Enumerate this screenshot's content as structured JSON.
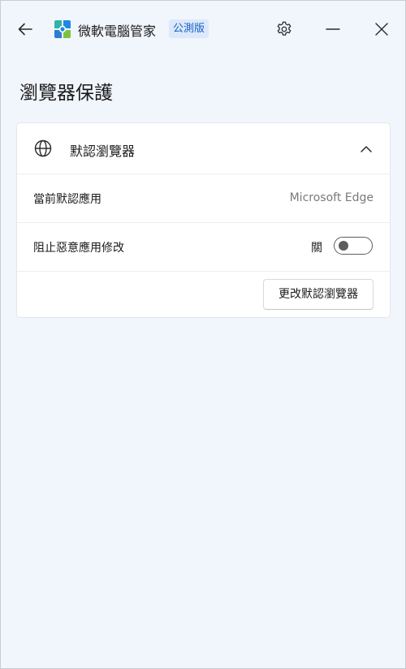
{
  "titlebar": {
    "app_name": "微軟電腦管家",
    "badge": "公測版"
  },
  "page": {
    "title": "瀏覽器保護"
  },
  "card": {
    "header_label": "默認瀏覽器",
    "rows": [
      {
        "label": "當前默認應用",
        "value": "Microsoft Edge"
      },
      {
        "label": "阻止惡意應用修改",
        "toggle_state": "關",
        "toggle_on": false
      }
    ],
    "change_button": "更改默認瀏覽器"
  },
  "colors": {
    "background": "#f1f5fc",
    "card": "#ffffff",
    "badge_bg": "#dce8fb",
    "badge_text": "#1760c4",
    "muted_text": "#7a7a7a",
    "toggle": "#5d5d5d"
  },
  "icons": {
    "back": "arrow-left-icon",
    "logo": "pc-manager-logo-icon",
    "settings": "gear-icon",
    "minimize": "minimize-icon",
    "close": "close-icon",
    "globe": "globe-icon",
    "collapse": "chevron-up-icon"
  }
}
